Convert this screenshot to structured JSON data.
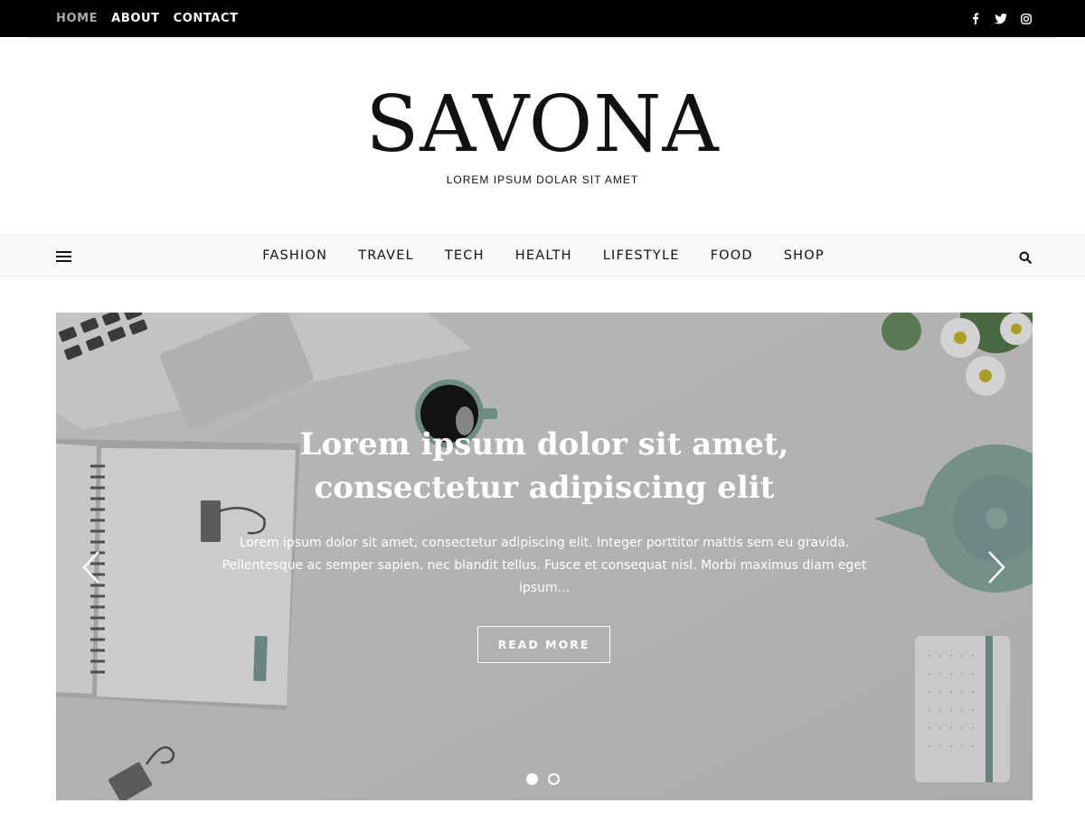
{
  "topbar": {
    "links": [
      {
        "label": "HOME",
        "active": true
      },
      {
        "label": "ABOUT",
        "active": false
      },
      {
        "label": "CONTACT",
        "active": false
      }
    ],
    "social_icons": [
      "facebook-icon",
      "twitter-icon",
      "instagram-icon"
    ]
  },
  "header": {
    "logo": "SAVONA",
    "tagline": "LOREM IPSUM DOLAR SIT AMET"
  },
  "mainnav": {
    "items": [
      "FASHION",
      "TRAVEL",
      "TECH",
      "HEALTH",
      "LIFESTYLE",
      "FOOD",
      "SHOP"
    ],
    "menu_icon": "hamburger-icon",
    "search_icon": "search-icon"
  },
  "slider": {
    "title": "Lorem ipsum dolor sit amet, consectetur adipiscing elit",
    "excerpt": "Lorem ipsum dolor sit amet, consectetur adipiscing elit. Integer porttitor mattis sem eu gravida. Pellentesque ac semper sapien, nec blandit tellus. Fusce et consequat nisl. Morbi maximus diam eget ipsum...",
    "button_label": "READ MORE",
    "slide_count": 2,
    "active_slide": 1,
    "colors": {
      "accent_teal": "#86a8a0",
      "image_bg": "#cfcfcf"
    }
  }
}
